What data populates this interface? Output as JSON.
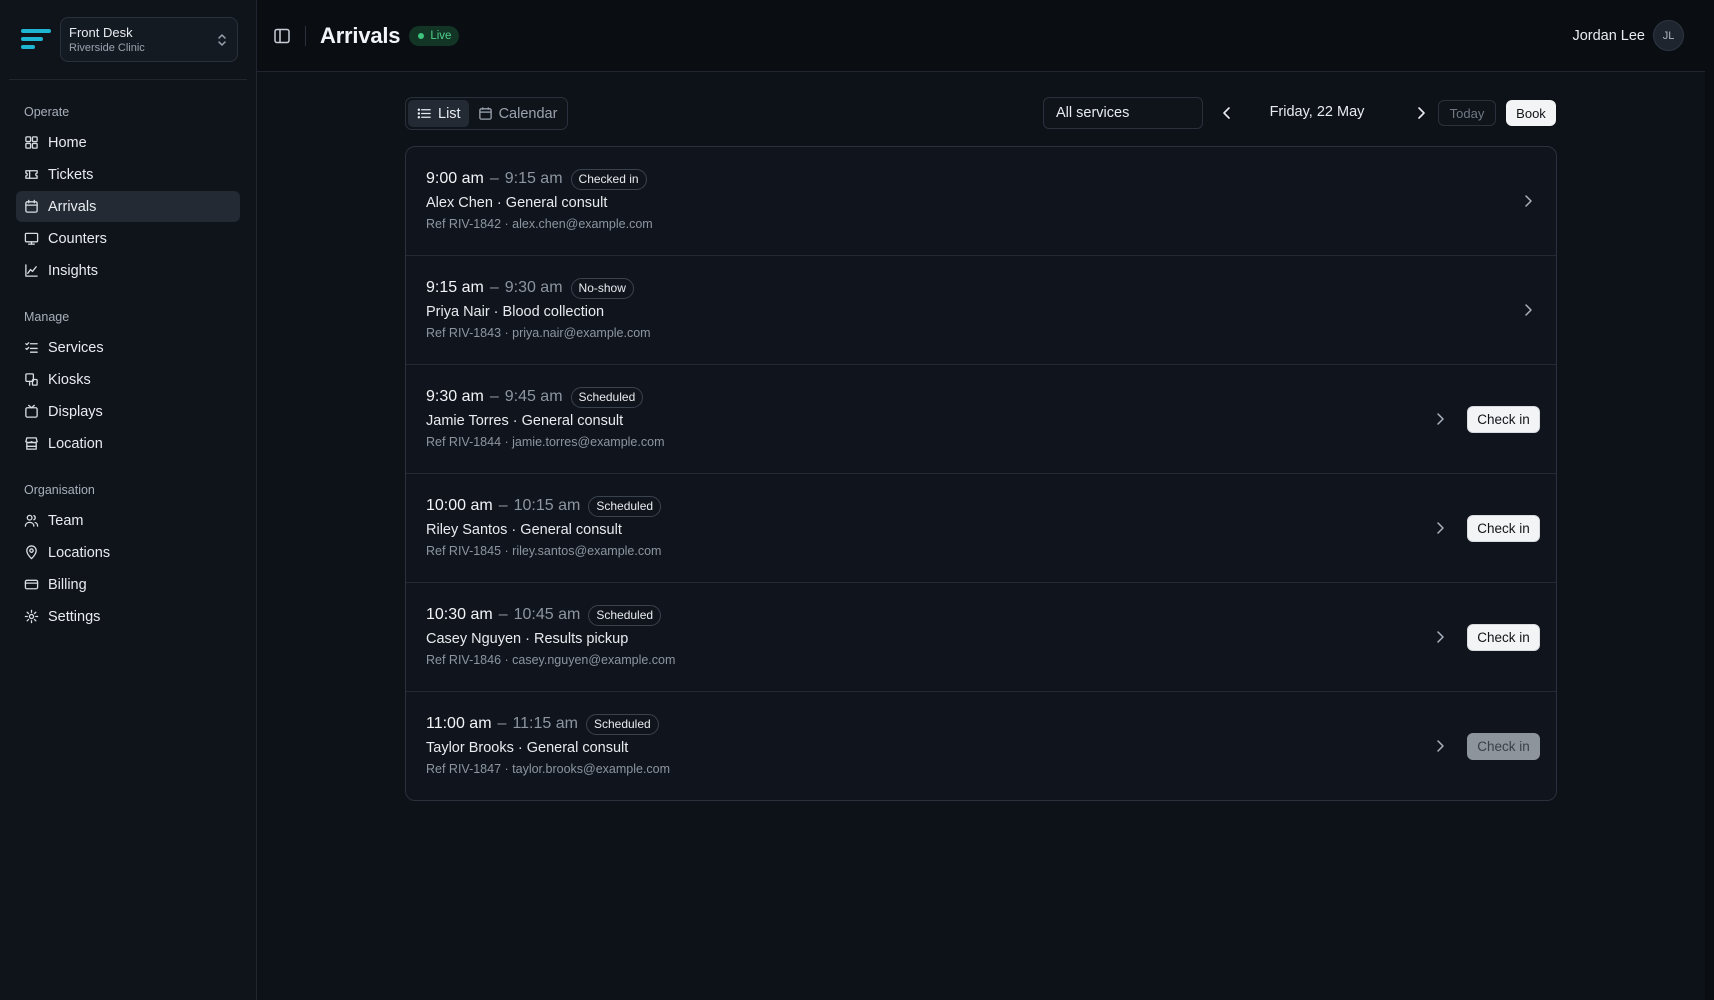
{
  "workspace": {
    "name": "Front Desk",
    "location": "Riverside Clinic"
  },
  "nav": [
    {
      "title": "Operate",
      "items": [
        {
          "label": "Home",
          "icon": "home",
          "active": false
        },
        {
          "label": "Tickets",
          "icon": "ticket",
          "active": false
        },
        {
          "label": "Arrivals",
          "icon": "calendar",
          "active": true
        },
        {
          "label": "Counters",
          "icon": "monitor",
          "active": false
        },
        {
          "label": "Insights",
          "icon": "chart",
          "active": false
        }
      ]
    },
    {
      "title": "Manage",
      "items": [
        {
          "label": "Services",
          "icon": "list-check",
          "active": false
        },
        {
          "label": "Kiosks",
          "icon": "kiosk",
          "active": false
        },
        {
          "label": "Displays",
          "icon": "tv",
          "active": false
        },
        {
          "label": "Location",
          "icon": "store",
          "active": false
        }
      ]
    },
    {
      "title": "Organisation",
      "items": [
        {
          "label": "Team",
          "icon": "users",
          "active": false
        },
        {
          "label": "Locations",
          "icon": "pin",
          "active": false
        },
        {
          "label": "Billing",
          "icon": "card",
          "active": false
        },
        {
          "label": "Settings",
          "icon": "gear",
          "active": false
        }
      ]
    }
  ],
  "header": {
    "title": "Arrivals",
    "live_label": "Live",
    "user_name": "Jordan Lee",
    "user_initials": "JL"
  },
  "toolbar": {
    "list_label": "List",
    "calendar_label": "Calendar",
    "service_filter": "All services",
    "date": "Friday, 22 May",
    "today_label": "Today",
    "book_label": "Book"
  },
  "appointments": [
    {
      "start": "9:00 am",
      "end": "9:15 am",
      "status": "Checked in",
      "patient": "Alex Chen",
      "service": "General consult",
      "ref": "Ref RIV-1842",
      "email": "alex.chen@example.com",
      "action": null
    },
    {
      "start": "9:15 am",
      "end": "9:30 am",
      "status": "No-show",
      "patient": "Priya Nair",
      "service": "Blood collection",
      "ref": "Ref RIV-1843",
      "email": "priya.nair@example.com",
      "action": null
    },
    {
      "start": "9:30 am",
      "end": "9:45 am",
      "status": "Scheduled",
      "patient": "Jamie Torres",
      "service": "General consult",
      "ref": "Ref RIV-1844",
      "email": "jamie.torres@example.com",
      "action": "Check in",
      "action_disabled": false
    },
    {
      "start": "10:00 am",
      "end": "10:15 am",
      "status": "Scheduled",
      "patient": "Riley Santos",
      "service": "General consult",
      "ref": "Ref RIV-1845",
      "email": "riley.santos@example.com",
      "action": "Check in",
      "action_disabled": false
    },
    {
      "start": "10:30 am",
      "end": "10:45 am",
      "status": "Scheduled",
      "patient": "Casey Nguyen",
      "service": "Results pickup",
      "ref": "Ref RIV-1846",
      "email": "casey.nguyen@example.com",
      "action": "Check in",
      "action_disabled": false
    },
    {
      "start": "11:00 am",
      "end": "11:15 am",
      "status": "Scheduled",
      "patient": "Taylor Brooks",
      "service": "General consult",
      "ref": "Ref RIV-1847",
      "email": "taylor.brooks@example.com",
      "action": "Check in",
      "action_disabled": true
    }
  ],
  "colors": {
    "accent_logo": "#1fb6d4",
    "live": "#3ec47c",
    "background": "#0d1118"
  }
}
